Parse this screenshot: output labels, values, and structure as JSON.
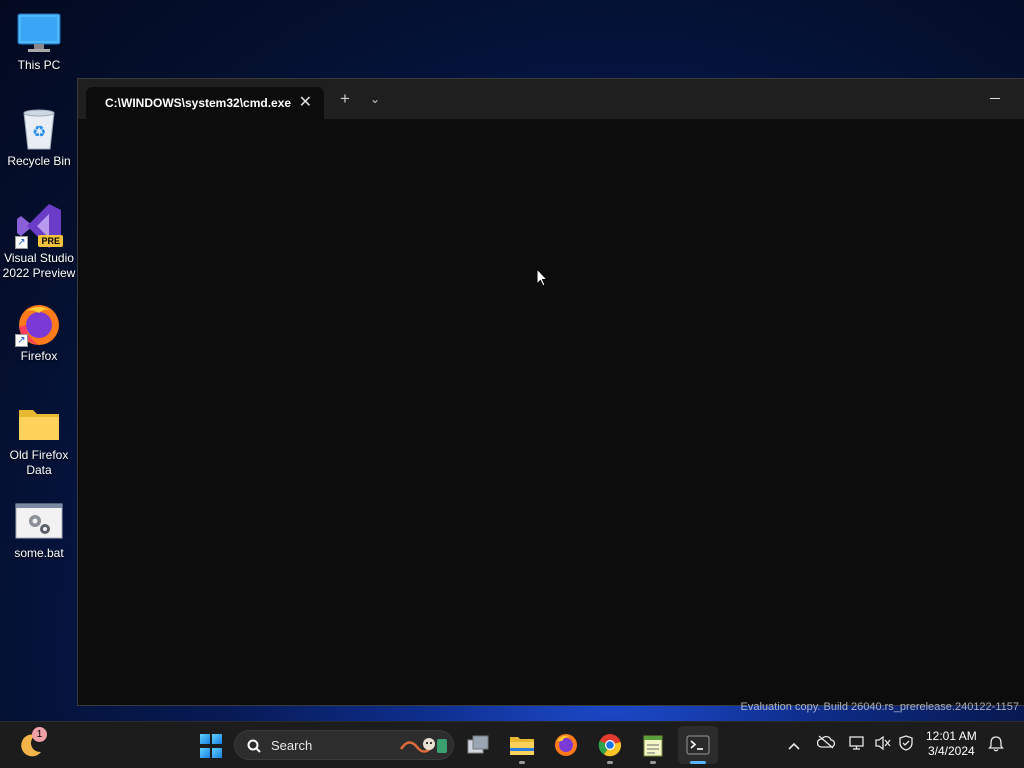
{
  "desktop": {
    "icons": [
      {
        "label": "This PC",
        "icon": "monitor-icon"
      },
      {
        "label": "Recycle Bin",
        "icon": "recycle-bin-icon"
      },
      {
        "label": "Visual Studio\n2022 Preview",
        "icon": "visual-studio-icon",
        "badge": "PRE"
      },
      {
        "label": "Firefox",
        "icon": "firefox-icon"
      },
      {
        "label": "Old Firefox\nData",
        "icon": "folder-icon"
      },
      {
        "label": "some.bat",
        "icon": "batch-file-icon"
      }
    ]
  },
  "terminal": {
    "tab_title": "C:\\WINDOWS\\system32\\cmd.exe",
    "new_tab": "+",
    "close_glyph": "✕",
    "dropdown_glyph": "⌄"
  },
  "watermark": "Evaluation copy. Build 26040.rs_prerelease.240122-1157",
  "taskbar": {
    "search_placeholder": "Search",
    "widget_badge": "1",
    "apps": [
      "task-view",
      "file-explorer",
      "firefox",
      "chrome",
      "notepad",
      "terminal"
    ],
    "clock_time": "12:01 AM",
    "clock_date": "3/4/2024"
  },
  "colors": {
    "accent": "#59b3ff",
    "terminal_bg": "#0c0c0c",
    "titlebar_bg": "#1f1f1f",
    "taskbar_bg": "#1c1c1c"
  }
}
